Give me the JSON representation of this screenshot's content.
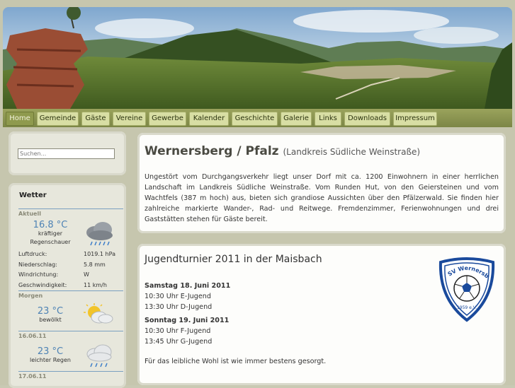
{
  "nav": {
    "items": [
      {
        "label": "Home",
        "active": true
      },
      {
        "label": "Gemeinde"
      },
      {
        "label": "Gäste"
      },
      {
        "label": "Vereine"
      },
      {
        "label": "Gewerbe"
      },
      {
        "label": "Kalender"
      },
      {
        "label": "Geschichte"
      },
      {
        "label": "Galerie"
      },
      {
        "label": "Links"
      },
      {
        "label": "Downloads"
      },
      {
        "label": "Impressum"
      }
    ]
  },
  "search": {
    "placeholder": "Suchen..."
  },
  "weather": {
    "title": "Wetter",
    "current": {
      "heading": "Aktuell",
      "temp": "16.8 °C",
      "desc1": "kräftiger",
      "desc2": "Regenschauer",
      "icon": "rain-cloud-icon",
      "details": [
        {
          "label": "Luftdruck:",
          "value": "1019.1 hPa"
        },
        {
          "label": "Niederschlag:",
          "value": "5.8 mm"
        },
        {
          "label": "Windrichtung:",
          "value": "W"
        },
        {
          "label": "Geschwindigkeit:",
          "value": "11 km/h"
        }
      ]
    },
    "forecast": [
      {
        "heading": "Morgen",
        "temp": "23 °C",
        "desc": "bewölkt",
        "icon": "sun-cloud-icon"
      },
      {
        "heading": "16.06.11",
        "temp": "23 °C",
        "desc": "leichter Regen",
        "icon": "light-rain-icon"
      },
      {
        "heading": "17.06.11"
      }
    ]
  },
  "main": {
    "title": "Wernersberg / Pfalz",
    "subtitle": "(Landkreis Südliche Weinstraße)",
    "intro": "Ungestört vom Durchgangsverkehr liegt unser Dorf mit ca. 1200 Einwohnern in einer herrlichen Landschaft im Landkreis Südliche Weinstraße. Vom Runden Hut, von den Geiersteinen und vom Wachtfels (387 m hoch) aus, bieten sich grandiose Aussichten über den Pfälzerwald. Sie finden hier zahlreiche markierte Wander-, Rad- und Reitwege. Fremdenzimmer, Ferienwohnungen und drei Gaststätten stehen für Gäste bereit."
  },
  "news": {
    "title": "Jugendturnier 2011 in der Maisbach",
    "day1": "Samstag 18. Juni 2011",
    "day1_items": [
      "10:30 Uhr E-Jugend",
      "13:30 Uhr D-Jugend"
    ],
    "day2": "Sonntag 19. Juni 2011",
    "day2_items": [
      "10:30 Uhr F-Jugend",
      "13:45 Uhr G-Jugend"
    ],
    "footer": "Für das leibliche Wohl ist wie immer bestens gesorgt.",
    "logo": {
      "top": "SV Wernersberg",
      "bottom": "1959 e.V."
    }
  },
  "colors": {
    "accent": "#8f9a4e",
    "temp": "#4e83b5",
    "separator": "#7aa0c0"
  }
}
